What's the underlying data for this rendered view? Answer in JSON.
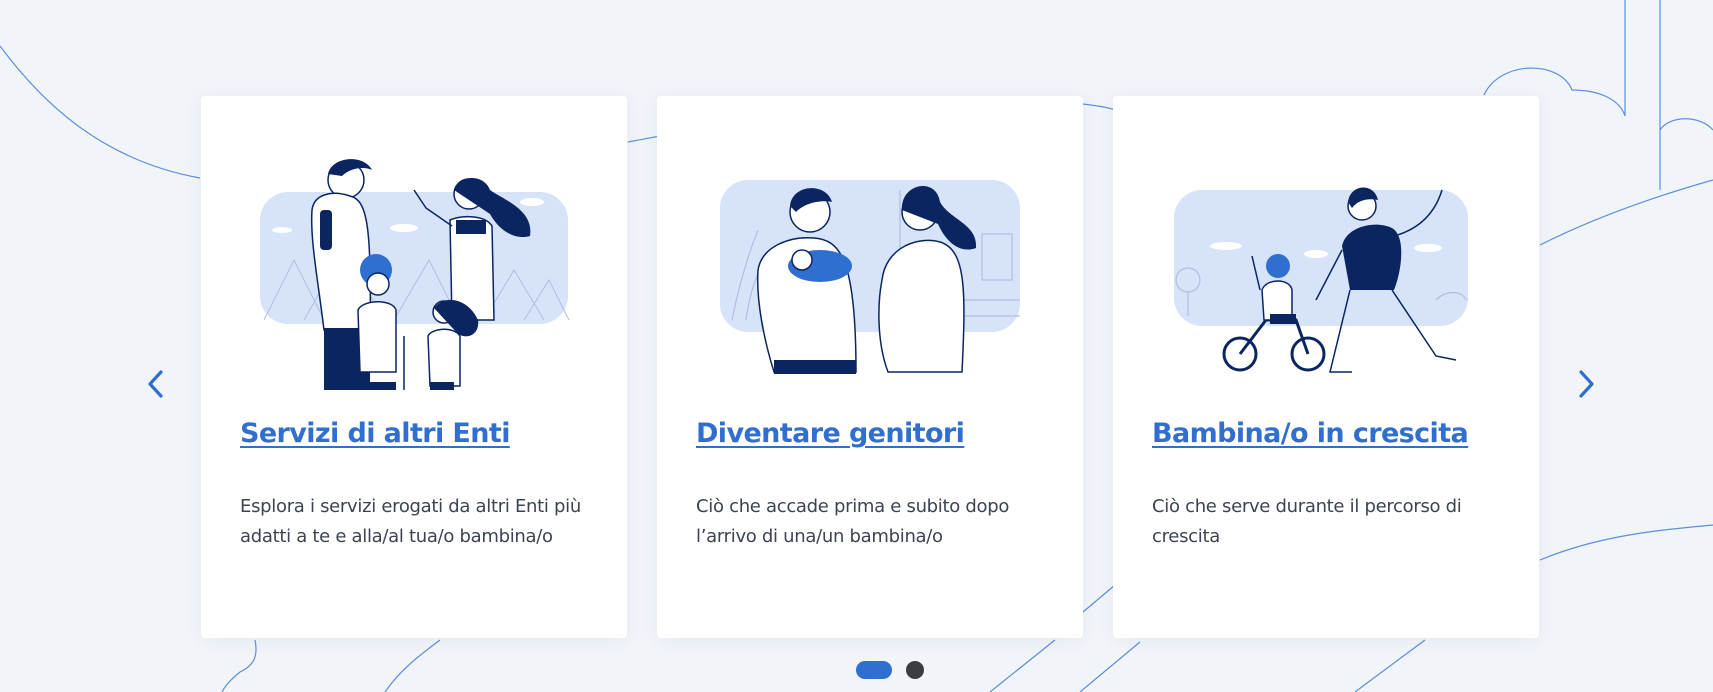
{
  "carousel": {
    "cards": [
      {
        "title": "Servizi di altri Enti",
        "description": "Esplora i servizi erogati da altri Enti più adatti a te e alla/al tua/o bambina/o",
        "illustration": "family-hiking-illustration"
      },
      {
        "title": "Diventare genitori",
        "description": "Ciò che accade prima e subito dopo l’arrivo di una/un bambina/o",
        "illustration": "expecting-parents-illustration"
      },
      {
        "title": "Bambina/o in crescita",
        "description": "Ciò che serve durante il percorso di crescita",
        "illustration": "child-bicycle-illustration"
      }
    ],
    "prev_icon": "chevron-left-icon",
    "next_icon": "chevron-right-icon",
    "pagination": {
      "total_pages": 2,
      "active_page": 1
    }
  },
  "colors": {
    "accent": "#2f6fd0",
    "navy": "#0a2560",
    "light_blue": "#d6e3f8",
    "text": "#3c4451",
    "background": "#f1f4f9",
    "inactive_dot": "#3a3d42"
  }
}
